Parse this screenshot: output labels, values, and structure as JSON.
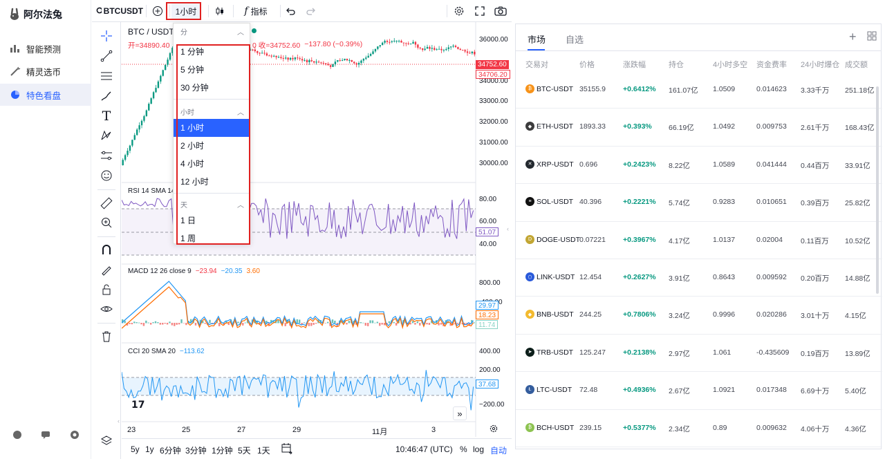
{
  "app": {
    "brand": "阿尔法兔"
  },
  "sidebar": {
    "items": [
      {
        "label": "智能预测"
      },
      {
        "label": "精灵选币"
      },
      {
        "label": "特色看盘"
      }
    ]
  },
  "toolbar": {
    "symbol": "BTCUSDT",
    "interval": "1小时",
    "indicators": "指标"
  },
  "chart": {
    "symbol_title": "BTC / USDT",
    "ohlc_open_label": "开=34890.40",
    "ohlc_close_label": "0 收=34752.60",
    "ohlc_change": "−137.80 (−0.39%)",
    "price_axis": [
      "36000.00",
      "35000.00",
      "34000.00",
      "33000.00",
      "32000.00",
      "31000.00",
      "30000.00"
    ],
    "price_last": "34752.60",
    "price_other": "34706.20",
    "rsi_title": "RSI 14 SMA 14",
    "rsi_axis": [
      "80.00",
      "60.00",
      "40.00"
    ],
    "rsi_value": "51.07",
    "macd_title": "MACD 12 26 close 9",
    "macd_v1": "−23.94",
    "macd_v2": "−20.35",
    "macd_v3": "3.60",
    "macd_axis": [
      "800.00",
      "400.00"
    ],
    "macd_lbl1": "29.97",
    "macd_lbl2": "18.23",
    "macd_lbl3": "11.74",
    "cci_title": "CCI 20 SMA 20",
    "cci_value_t": "−113.62",
    "cci_axis": [
      "400.00",
      "200.00",
      "−200.00"
    ],
    "cci_value": "37.68",
    "time_axis": [
      "23",
      "25",
      "27",
      "29",
      "11月",
      "3"
    ],
    "logo": "17"
  },
  "dropdown": {
    "sections": [
      {
        "title": "分",
        "items": [
          "1 分钟",
          "5 分钟",
          "30 分钟"
        ]
      },
      {
        "title": "小时",
        "items": [
          "1 小时",
          "2 小时",
          "4 小时",
          "12 小时"
        ]
      },
      {
        "title": "天",
        "items": [
          "1 日",
          "1 周"
        ]
      }
    ],
    "selected": "1 小时"
  },
  "bottombar": {
    "ranges": [
      "5y",
      "1y",
      "6分钟",
      "3分钟",
      "1分钟",
      "5天",
      "1天"
    ],
    "clock": "10:46:47 (UTC)",
    "pct": "%",
    "log": "log",
    "auto": "自动"
  },
  "market": {
    "tabs": [
      "市场",
      "自选"
    ],
    "headers": [
      "交易对",
      "价格",
      "涨跌幅",
      "持仓",
      "4小时多空",
      "资金费率",
      "24小时爆仓",
      "成交额"
    ],
    "rows": [
      {
        "pair": "BTC-USDT",
        "price": "35155.9",
        "change": "+0.6412%",
        "oi": "161.07亿",
        "ls": "1.0509",
        "fund": "0.014623",
        "liq": "3.33千万",
        "vol": "251.18亿",
        "color": "#f7931a",
        "sym": "₿"
      },
      {
        "pair": "ETH-USDT",
        "price": "1893.33",
        "change": "+0.393%",
        "oi": "66.19亿",
        "ls": "1.0492",
        "fund": "0.009753",
        "liq": "2.61千万",
        "vol": "168.43亿",
        "color": "#3c3c3d",
        "sym": "◆"
      },
      {
        "pair": "XRP-USDT",
        "price": "0.696",
        "change": "+0.2423%",
        "oi": "8.22亿",
        "ls": "1.0589",
        "fund": "0.041444",
        "liq": "0.44百万",
        "vol": "33.91亿",
        "color": "#23292f",
        "sym": "✕"
      },
      {
        "pair": "SOL-USDT",
        "price": "40.396",
        "change": "+0.2221%",
        "oi": "5.74亿",
        "ls": "0.9283",
        "fund": "0.010651",
        "liq": "0.39百万",
        "vol": "25.82亿",
        "color": "#111",
        "sym": "≡"
      },
      {
        "pair": "DOGE-USDT",
        "price": "0.07221",
        "change": "+0.3967%",
        "oi": "4.17亿",
        "ls": "1.0137",
        "fund": "0.02004",
        "liq": "0.11百万",
        "vol": "10.52亿",
        "color": "#c2a633",
        "sym": "D"
      },
      {
        "pair": "LINK-USDT",
        "price": "12.454",
        "change": "+0.2627%",
        "oi": "3.91亿",
        "ls": "0.8643",
        "fund": "0.009592",
        "liq": "0.20百万",
        "vol": "14.88亿",
        "color": "#2a5ada",
        "sym": "⬡"
      },
      {
        "pair": "BNB-USDT",
        "price": "244.25",
        "change": "+0.7806%",
        "oi": "3.24亿",
        "ls": "0.9996",
        "fund": "0.020286",
        "liq": "3.01十万",
        "vol": "4.15亿",
        "color": "#f3ba2f",
        "sym": "◆"
      },
      {
        "pair": "TRB-USDT",
        "price": "125.247",
        "change": "+0.2138%",
        "oi": "2.97亿",
        "ls": "1.061",
        "fund": "-0.435609",
        "liq": "0.19百万",
        "vol": "13.89亿",
        "color": "#0c1e1a",
        "sym": "➤"
      },
      {
        "pair": "LTC-USDT",
        "price": "72.48",
        "change": "+0.4936%",
        "oi": "2.67亿",
        "ls": "1.0921",
        "fund": "0.017348",
        "liq": "6.69十万",
        "vol": "5.40亿",
        "color": "#345d9d",
        "sym": "Ł"
      },
      {
        "pair": "BCH-USDT",
        "price": "239.15",
        "change": "+0.5377%",
        "oi": "2.34亿",
        "ls": "0.89",
        "fund": "0.009632",
        "liq": "4.06十万",
        "vol": "4.36亿",
        "color": "#8dc351",
        "sym": "₿"
      }
    ]
  }
}
